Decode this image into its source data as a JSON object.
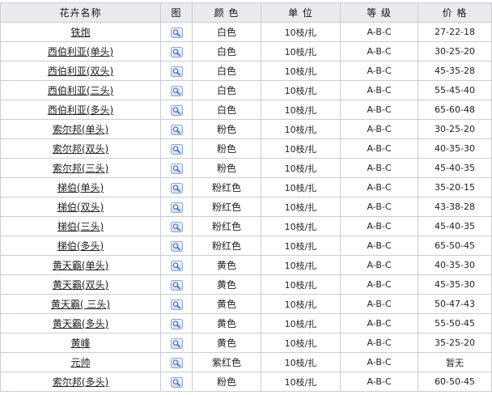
{
  "headers": {
    "name": "花卉名称",
    "image": "图",
    "color": "颜 色",
    "unit": "单 位",
    "grade": "等 级",
    "price": "价 格"
  },
  "icons": {
    "view": "magnifier-view-icon"
  },
  "colors": {
    "header_bg": "#e9ebee",
    "border": "#c9cdd2",
    "icon_blue": "#3f6fd0"
  },
  "rows": [
    {
      "name": "铁炮",
      "color": "白色",
      "unit": "10枝/扎",
      "grade": "A-B-C",
      "price": "27-22-18"
    },
    {
      "name": "西伯利亚(单头)",
      "color": "白色",
      "unit": "10枝/扎",
      "grade": "A-B-C",
      "price": "30-25-20"
    },
    {
      "name": "西伯利亚(双头)",
      "color": "白色",
      "unit": "10枝/扎",
      "grade": "A-B-C",
      "price": "45-35-28"
    },
    {
      "name": "西伯利亚(三头)",
      "color": "白色",
      "unit": "10枝/扎",
      "grade": "A-B-C",
      "price": "55-45-40"
    },
    {
      "name": "西伯利亚(多头)",
      "color": "白色",
      "unit": "10枝/扎",
      "grade": "A-B-C",
      "price": "65-60-48"
    },
    {
      "name": "索尔邦(单头)",
      "color": "粉色",
      "unit": "10枝/扎",
      "grade": "A-B-C",
      "price": "30-25-20"
    },
    {
      "name": "索尔邦(双头)",
      "color": "粉色",
      "unit": "10枝/扎",
      "grade": "A-B-C",
      "price": "40-35-30"
    },
    {
      "name": "索尔邦(三头)",
      "color": "粉色",
      "unit": "10枝/扎",
      "grade": "A-B-C",
      "price": "45-40-35"
    },
    {
      "name": "梯伯(单头)",
      "color": "粉红色",
      "unit": "10枝/扎",
      "grade": "A-B-C",
      "price": "35-20-15"
    },
    {
      "name": "梯伯(双头)",
      "color": "粉红色",
      "unit": "10枝/扎",
      "grade": "A-B-C",
      "price": "43-38-28"
    },
    {
      "name": "梯伯(三头)",
      "color": "粉红色",
      "unit": "10枝/扎",
      "grade": "A-B-C",
      "price": "45-40-35"
    },
    {
      "name": "梯伯(多头)",
      "color": "粉红色",
      "unit": "10枝/扎",
      "grade": "A-B-C",
      "price": "65-50-45"
    },
    {
      "name": "黄天霸(单头)",
      "color": "黄色",
      "unit": "10枝/扎",
      "grade": "A-B-C",
      "price": "40-35-30"
    },
    {
      "name": "黄天霸(双头)",
      "color": "黄色",
      "unit": "10枝/扎",
      "grade": "A-B-C",
      "price": "45-35-30"
    },
    {
      "name": "黄天霸( 三头)",
      "color": "黄色",
      "unit": "10枝/扎",
      "grade": "A-B-C",
      "price": "50-47-43"
    },
    {
      "name": "黄天霸(多头)",
      "color": "黄色",
      "unit": "10枝/扎",
      "grade": "A-B-C",
      "price": "55-50-45"
    },
    {
      "name": "黄峰",
      "color": "黄色",
      "unit": "10枝/扎",
      "grade": "A-B-C",
      "price": "35-25-20"
    },
    {
      "name": "元帅",
      "color": "紫红色",
      "unit": "10枝/扎",
      "grade": "A-B-C",
      "price": "暂无"
    },
    {
      "name": "索尔邦(多头)",
      "color": "粉色",
      "unit": "10枝/扎",
      "grade": "A-B-C",
      "price": "60-50-45"
    }
  ]
}
